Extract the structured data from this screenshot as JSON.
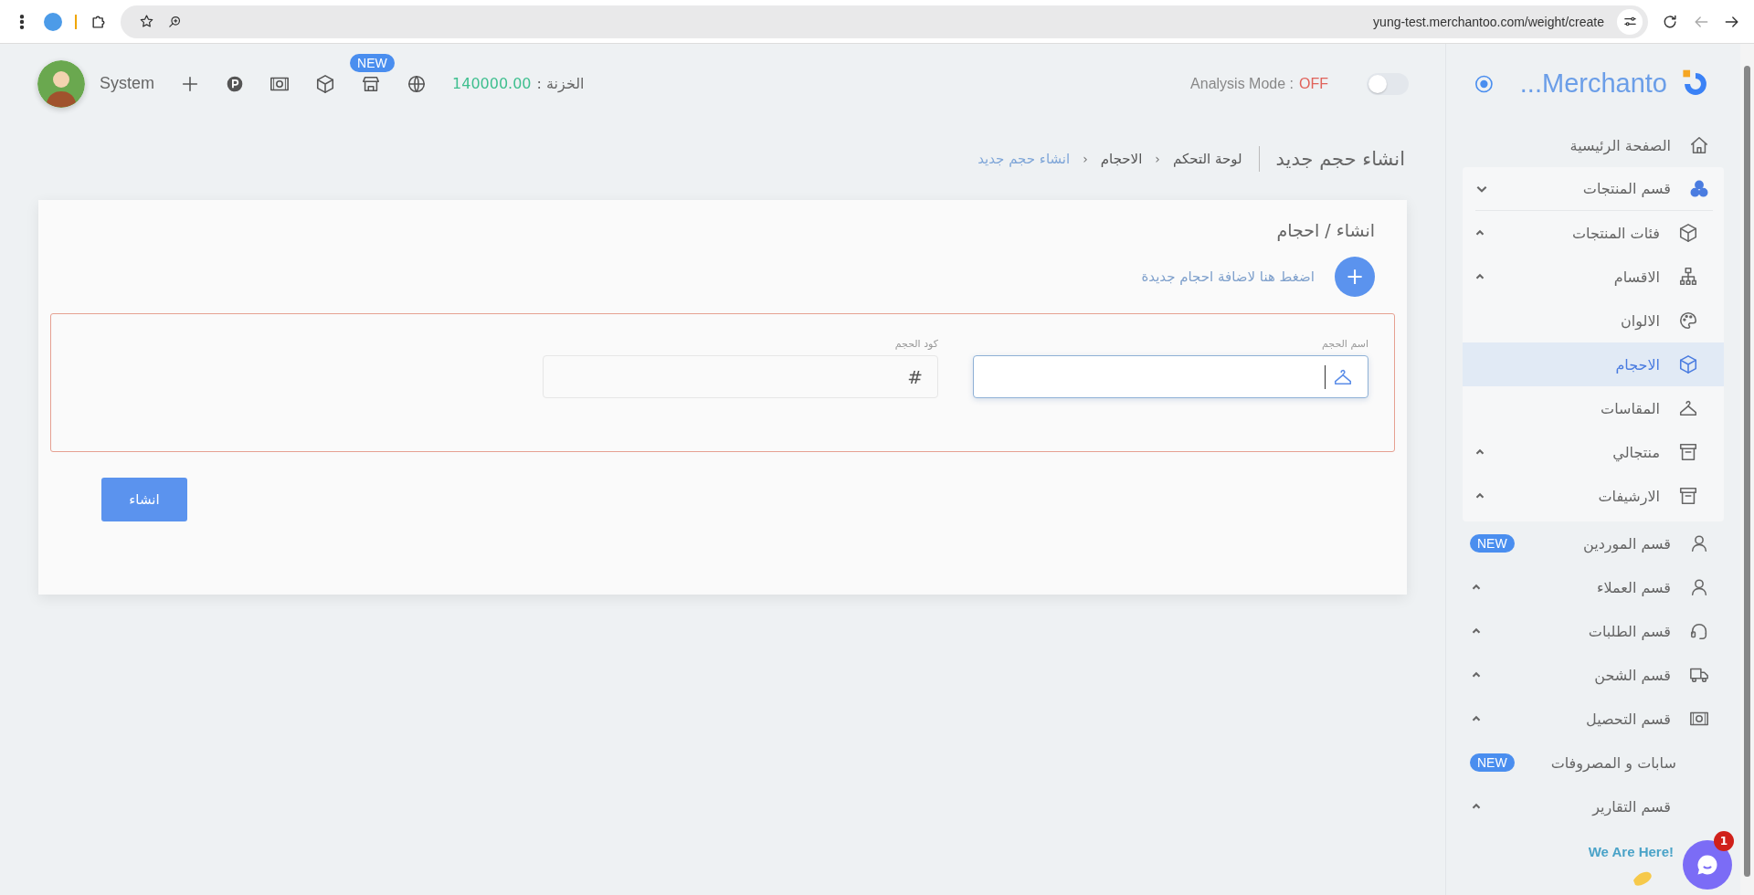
{
  "browser": {
    "url": "yung-test.merchantoo.com/weight/create"
  },
  "header": {
    "user": "System",
    "new_badge": "NEW",
    "treasury_label": "الخزنة :",
    "treasury_amount": "140000.00",
    "analysis_label": "Analysis Mode :",
    "analysis_state": "OFF",
    "analysis_on": false
  },
  "sidebar": {
    "brand": "...Merchanto",
    "items": [
      {
        "label": "الصفحة الرئيسية",
        "kind": "link",
        "selected": false
      },
      {
        "label": "قسم المنتجات",
        "kind": "group",
        "expanded": true,
        "selected": false,
        "children": [
          {
            "label": "فئات المنتجات",
            "kind": "group",
            "expanded": false,
            "selected": false
          },
          {
            "label": "الاقسام",
            "kind": "group",
            "expanded": false,
            "selected": false
          },
          {
            "label": "الالوان",
            "kind": "link",
            "selected": false
          },
          {
            "label": "الاحجام",
            "kind": "link",
            "selected": true
          },
          {
            "label": "المقاسات",
            "kind": "link",
            "selected": false
          },
          {
            "label": "منتجالي",
            "kind": "group",
            "expanded": false,
            "selected": false
          },
          {
            "label": "الارشيفات",
            "kind": "group",
            "expanded": false,
            "selected": false
          }
        ]
      },
      {
        "label": "قسم الموردين",
        "kind": "link",
        "selected": false,
        "badge": "NEW"
      },
      {
        "label": "قسم العملاء",
        "kind": "group",
        "expanded": false,
        "selected": false
      },
      {
        "label": "قسم الطلبات",
        "kind": "group",
        "expanded": false,
        "selected": false
      },
      {
        "label": "قسم الشحن",
        "kind": "group",
        "expanded": false,
        "selected": false
      },
      {
        "label": "قسم التحصيل",
        "kind": "group",
        "expanded": false,
        "selected": false
      },
      {
        "label": "سابات و المصروفات",
        "kind": "link",
        "selected": false,
        "badge": "NEW"
      },
      {
        "label": "قسم التقارير",
        "kind": "group",
        "expanded": false,
        "selected": false
      }
    ]
  },
  "page": {
    "title": "انشاء حجم جديد",
    "breadcrumb_separator": "‹",
    "breadcrumb": [
      {
        "label": "لوحة التحكم",
        "current": false
      },
      {
        "label": "الاحجام",
        "current": false
      },
      {
        "label": "انشاء حجم جديد",
        "current": true
      }
    ]
  },
  "card": {
    "title": "انشاء / احجام",
    "add_symbol": "+",
    "add_link": "اضغط هنا لاضافة احجام جديدة",
    "invalid": true,
    "fields": [
      {
        "label": "اسم الحجم",
        "focused": true
      },
      {
        "label": "كود الحجم",
        "symbol": "#",
        "focused": false
      }
    ],
    "submit": "انشاء"
  },
  "chat": {
    "tagline": "We Are Here!",
    "unread": "1"
  }
}
